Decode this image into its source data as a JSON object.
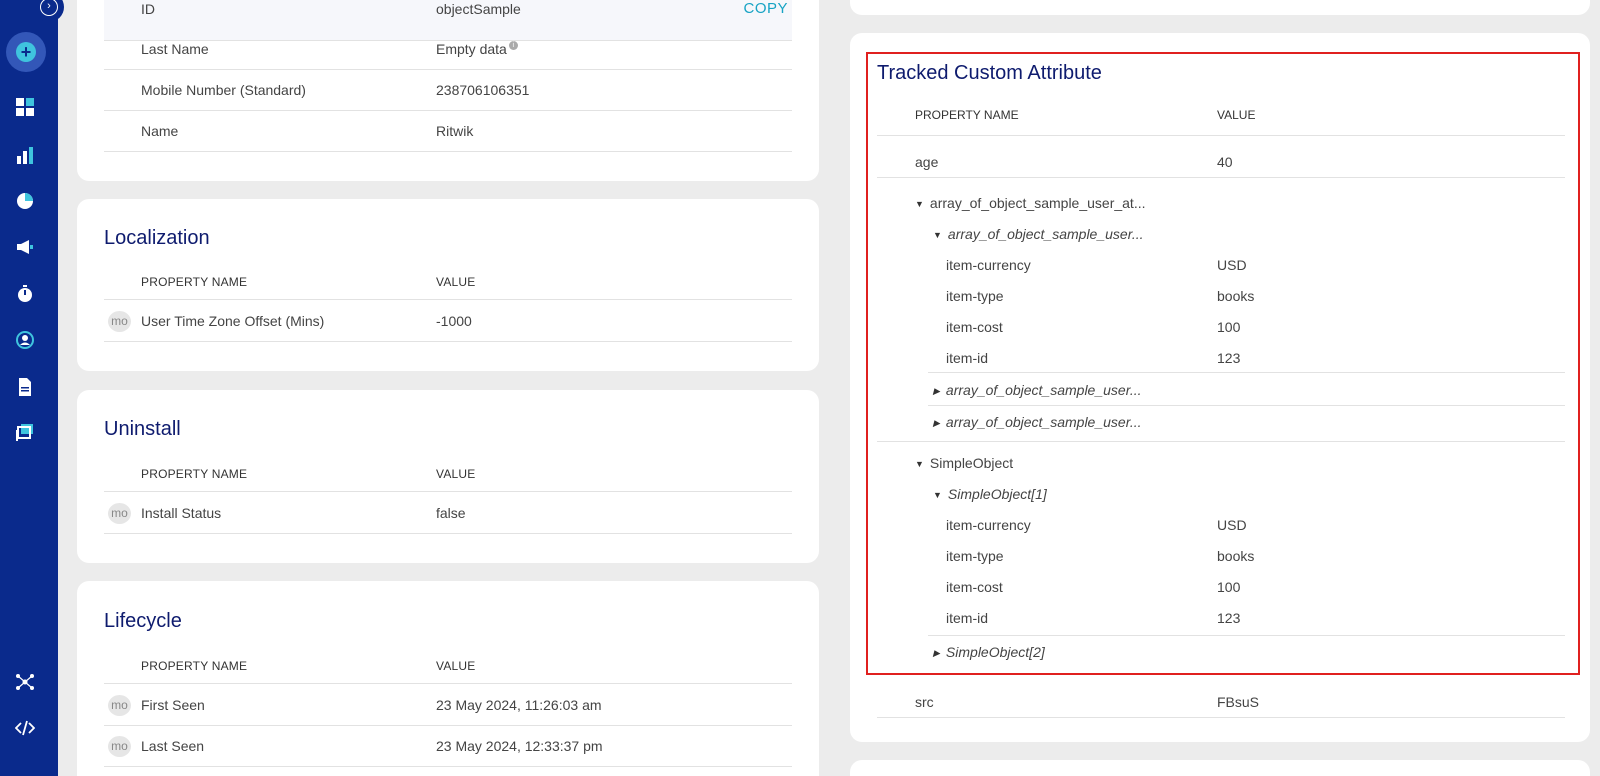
{
  "sidebar": {
    "collapse_icon": "chevron-right-icon",
    "add_icon": "plus-icon",
    "items": [
      {
        "icon": "dashboard-icon"
      },
      {
        "icon": "analytics-icon"
      },
      {
        "icon": "segments-icon"
      },
      {
        "icon": "campaigns-icon"
      },
      {
        "icon": "timer-icon"
      },
      {
        "icon": "user-profile-icon"
      },
      {
        "icon": "document-icon"
      },
      {
        "icon": "content-icon"
      },
      {
        "icon": "integrations-icon"
      },
      {
        "icon": "code-icon"
      }
    ]
  },
  "user_properties": {
    "rows": [
      {
        "key": "ID",
        "value": "objectSample"
      },
      {
        "key": "Last Name",
        "value": "Empty data"
      },
      {
        "key": "Mobile Number (Standard)",
        "value": "238706106351"
      },
      {
        "key": "Name",
        "value": "Ritwik"
      }
    ],
    "copy_label": "COPY"
  },
  "localization": {
    "title": "Localization",
    "col_name": "PROPERTY NAME",
    "col_value": "VALUE",
    "rows": [
      {
        "badge": "mo",
        "key": "User Time Zone Offset (Mins)",
        "value": "-1000"
      }
    ]
  },
  "uninstall": {
    "title": "Uninstall",
    "col_name": "PROPERTY NAME",
    "col_value": "VALUE",
    "rows": [
      {
        "badge": "mo",
        "key": "Install Status",
        "value": "false"
      }
    ]
  },
  "lifecycle": {
    "title": "Lifecycle",
    "col_name": "PROPERTY NAME",
    "col_value": "VALUE",
    "rows": [
      {
        "badge": "mo",
        "key": "First Seen",
        "value": "23 May 2024, 11:26:03 am"
      },
      {
        "badge": "mo",
        "key": "Last Seen",
        "value": "23 May 2024, 12:33:37 pm"
      }
    ]
  },
  "tracked": {
    "title": "Tracked Custom Attribute",
    "col_name": "PROPERTY NAME",
    "col_value": "VALUE",
    "age": {
      "key": "age",
      "value": "40"
    },
    "array_group": "array_of_object_sample_user_at...",
    "array_item1": "array_of_object_sample_user...",
    "array_item1_rows": [
      {
        "key": "item-currency",
        "value": "USD"
      },
      {
        "key": "item-type",
        "value": "books"
      },
      {
        "key": "item-cost",
        "value": "100"
      },
      {
        "key": "item-id",
        "value": "123"
      }
    ],
    "array_item2": "array_of_object_sample_user...",
    "array_item3": "array_of_object_sample_user...",
    "simple_group": "SimpleObject",
    "simple_item1": "SimpleObject[1]",
    "simple_item1_rows": [
      {
        "key": "item-currency",
        "value": "USD"
      },
      {
        "key": "item-type",
        "value": "books"
      },
      {
        "key": "item-cost",
        "value": "100"
      },
      {
        "key": "item-id",
        "value": "123"
      }
    ],
    "simple_item2": "SimpleObject[2]",
    "src": {
      "key": "src",
      "value": "FBsuS"
    }
  },
  "colors": {
    "sidebar": "#0a2a8c",
    "accent": "#17a3c4",
    "title": "#0e1b6e",
    "highlight": "#e0201f"
  }
}
